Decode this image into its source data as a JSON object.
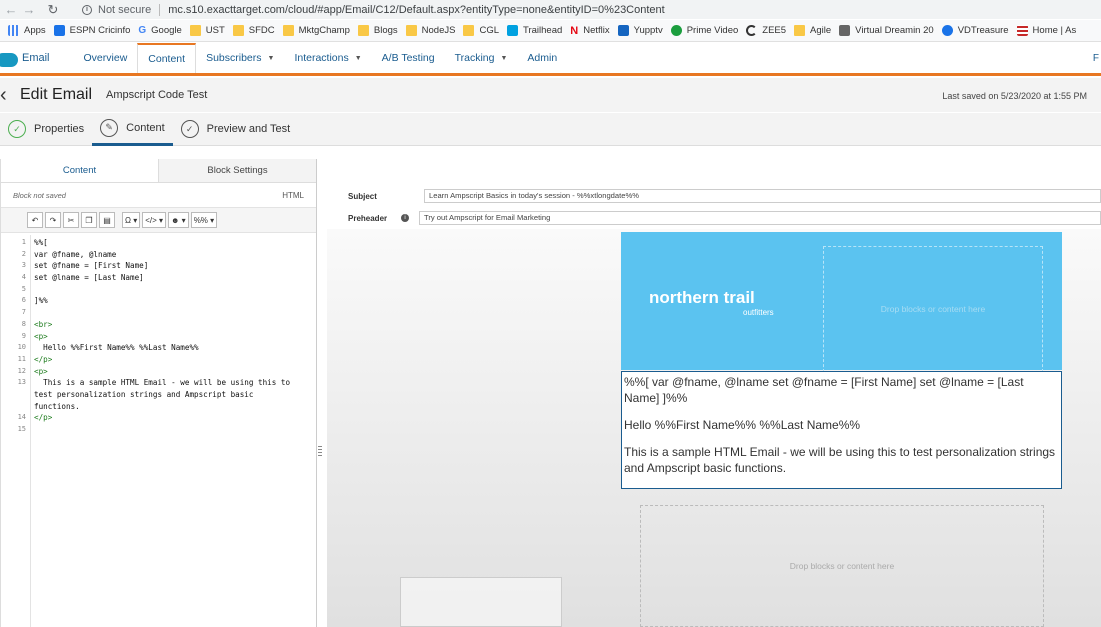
{
  "browser": {
    "not_secure": "Not secure",
    "url": "mc.s10.exacttarget.com/cloud/#app/Email/C12/Default.aspx?entityType=none&entityID=0%23Content",
    "bookmarks": [
      "Apps",
      "ESPN Cricinfo",
      "Google",
      "UST",
      "SFDC",
      "MktgChamp",
      "Blogs",
      "NodeJS",
      "CGL",
      "Trailhead",
      "Netflix",
      "Yupptv",
      "Prime Video",
      "ZEE5",
      "Agile",
      "Virtual Dreamin 20",
      "VDTreasure",
      "Home | As"
    ]
  },
  "nav": {
    "app": "Email",
    "items": [
      "Overview",
      "Content",
      "Subscribers",
      "Interactions",
      "A/B Testing",
      "Tracking",
      "Admin"
    ],
    "right_stub": "F"
  },
  "header": {
    "title": "Edit Email",
    "email_name": "Ampscript Code Test",
    "last_saved": "Last saved on 5/23/2020 at 1:55 PM"
  },
  "steps": [
    "Properties",
    "Content",
    "Preview and Test"
  ],
  "left_panel": {
    "tabs": [
      "Content",
      "Block Settings"
    ],
    "block_status": "Block not saved",
    "html_label": "HTML",
    "code_lines": [
      "%%[",
      "var @fname, @lname",
      "set @fname = [First Name]",
      "set @lname = [Last Name]",
      "",
      "]%%",
      "",
      "<br>",
      "<p>",
      "  Hello %%First Name%% %%Last Name%%",
      "</p>",
      "<p>",
      "  This is a sample HTML Email - we will be using this to",
      "test personalization strings and Ampscript basic",
      "functions.",
      "</p>",
      ""
    ],
    "line_numbers": [
      "1",
      "2",
      "3",
      "4",
      "5",
      "6",
      "7",
      "8",
      "9",
      "10",
      "11",
      "12",
      "13",
      "",
      "",
      "14",
      "15"
    ]
  },
  "fields": {
    "subject_label": "Subject",
    "subject_value": "Learn Ampscript Basics in today's session - %%xtlongdate%%",
    "preheader_label": "Preheader",
    "preheader_value": "Try out Ampscript for Email Marketing"
  },
  "canvas": {
    "logo": "northern trail",
    "logo_sub": "outfitters",
    "hero_drop": "Drop blocks or content here",
    "text_block": [
      "%%[ var @fname, @lname set @fname = [First Name] set @lname = [Last Name] ]%%",
      "Hello %%First Name%% %%Last Name%%",
      "This is a sample HTML Email - we will be using this to test personalization strings and Ampscript basic functions."
    ],
    "bottom_drop": "Drop blocks or content here"
  }
}
